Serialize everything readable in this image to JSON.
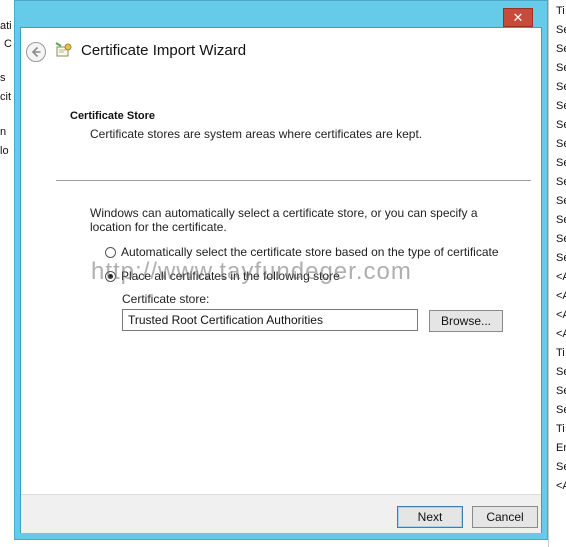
{
  "background_app": {
    "left_fragments": [
      "ati",
      "C",
      "s",
      "cit",
      "n",
      "lo"
    ],
    "right_fragments": [
      "Ti",
      "Se",
      "Se",
      "Se",
      "Se",
      "Se",
      "Se",
      "Se",
      "Se",
      "Se",
      "Se",
      "Se",
      "Se",
      "Se",
      "<A",
      "<A",
      "<A",
      "<A",
      "Ti",
      "Se",
      "Se",
      "Se",
      "Ti",
      "Er",
      "Se",
      "<A"
    ]
  },
  "window": {
    "close_label": "✕"
  },
  "wizard": {
    "title": "Certificate Import Wizard"
  },
  "page": {
    "section_title": "Certificate Store",
    "section_desc": "Certificate stores are system areas where certificates are kept.",
    "body_text": "Windows can automatically select a certificate store, or you can specify a location for the certificate.",
    "options": [
      {
        "label": "Automatically select the certificate store based on the type of certificate",
        "checked": false
      },
      {
        "label": "Place all certificates in the following store",
        "checked": true
      }
    ],
    "store_label": "Certificate store:",
    "store_value": "Trusted Root Certification Authorities",
    "browse_label": "Browse..."
  },
  "watermark": "http://www.tayfundeger.com",
  "footer": {
    "next_label": "Next",
    "cancel_label": "Cancel"
  }
}
